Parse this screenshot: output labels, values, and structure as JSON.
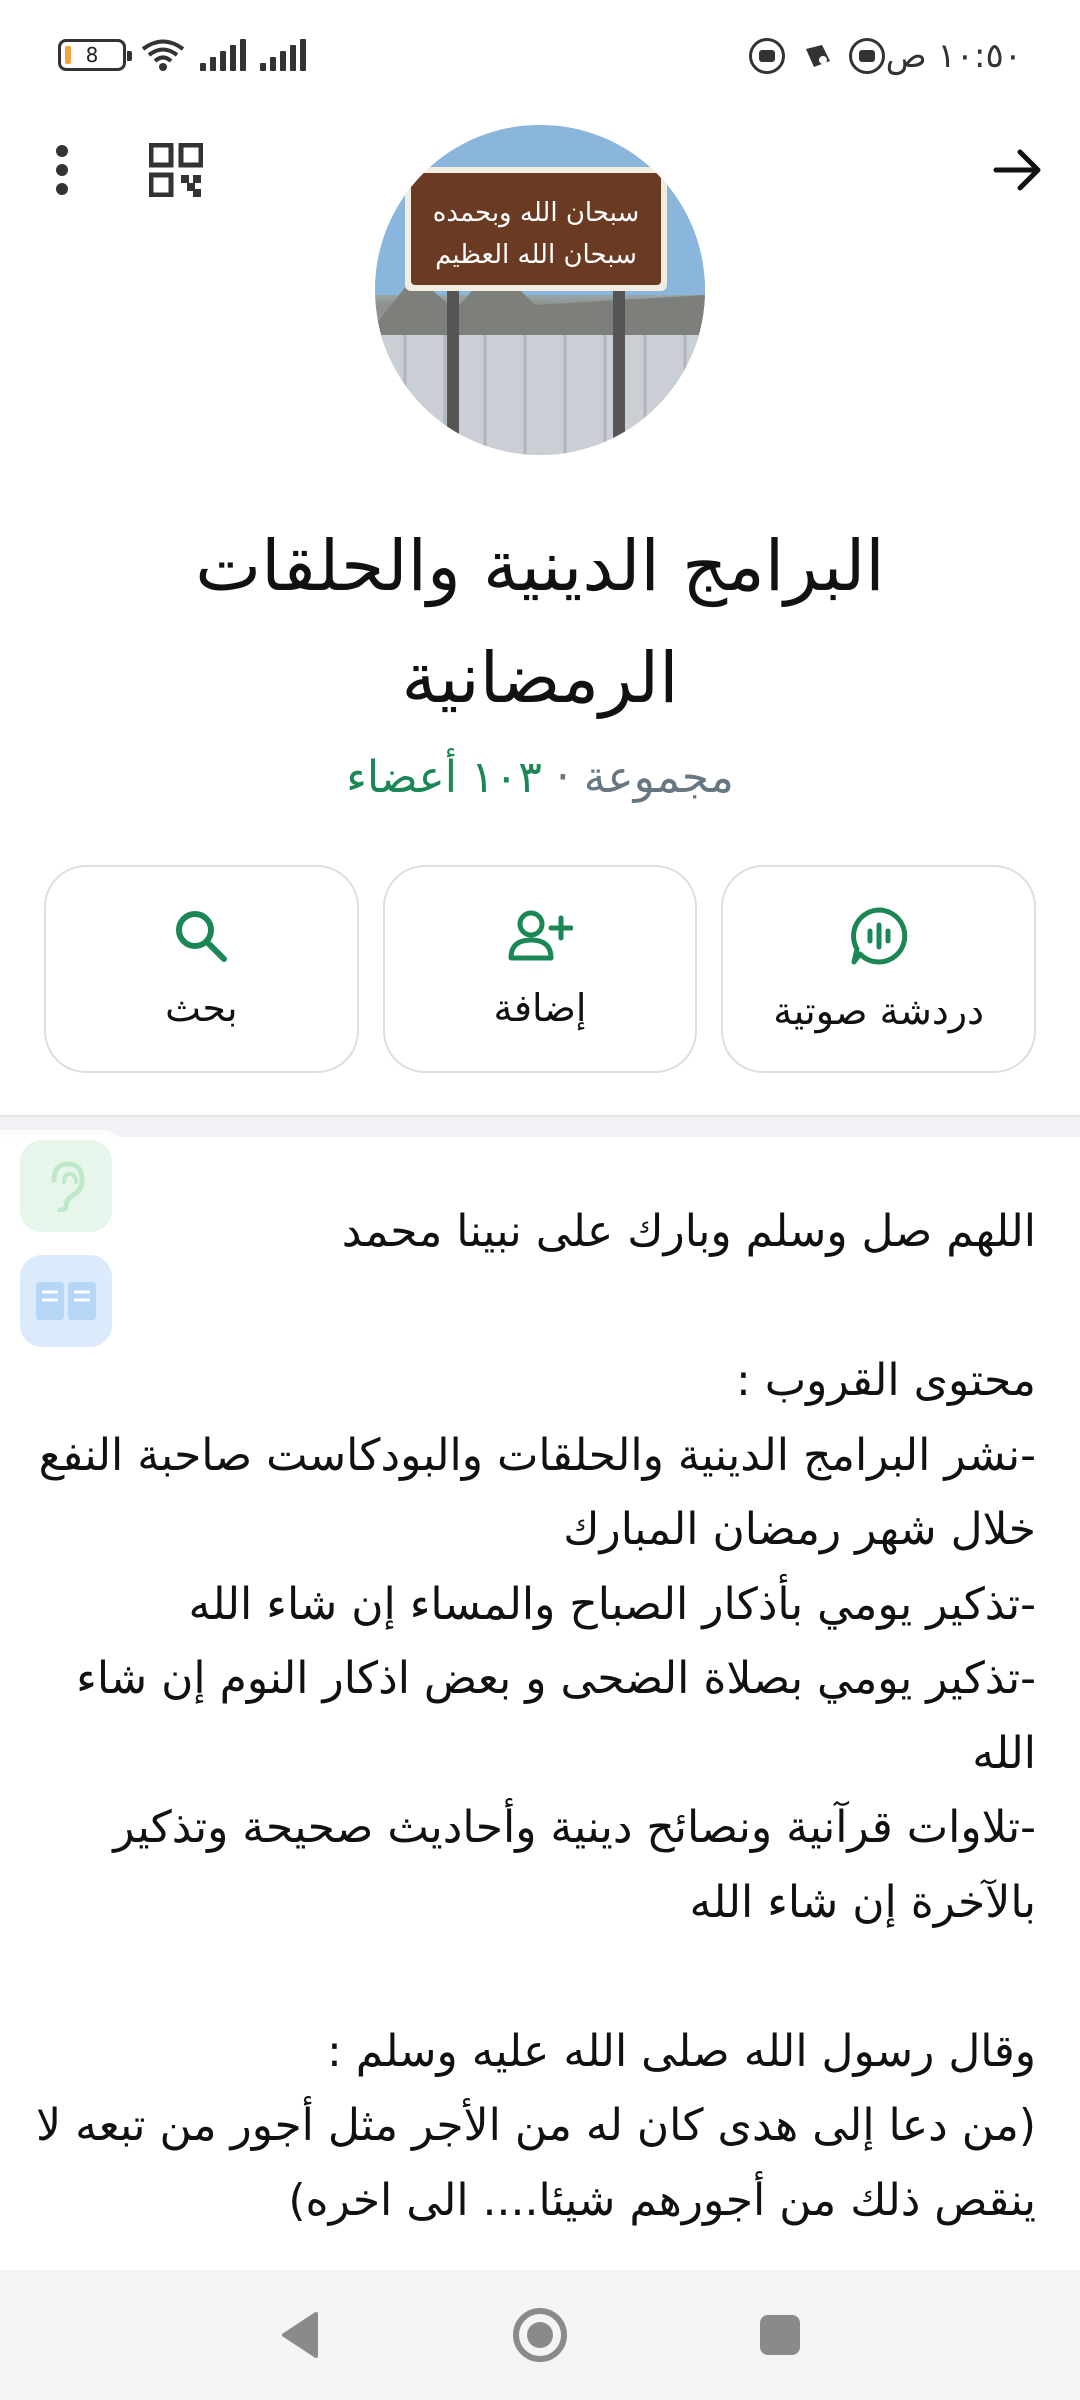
{
  "status_bar": {
    "time": "١٠:٥٠ ص",
    "battery": "8"
  },
  "top_bar": {
    "back_icon": "arrow-back-icon",
    "qr_icon": "qr-code-icon",
    "menu_icon": "more-vert-icon"
  },
  "avatar": {
    "sign_line1": "سبحان الله وبحمده",
    "sign_line2": "سبحان الله العظيم"
  },
  "group": {
    "title": "البرامج الدينية والحلقات الرمضانية",
    "type_label": "مجموعة",
    "separator": " · ",
    "members_label": "١٠٣ أعضاء"
  },
  "actions": [
    {
      "label": "دردشة صوتية",
      "icon": "voice-chat-icon"
    },
    {
      "label": "إضافة",
      "icon": "add-person-icon"
    },
    {
      "label": "بحث",
      "icon": "search-icon"
    }
  ],
  "description": "اللهم صل وسلم وبارك على نبينا محمد\n\nمحتوى القروب :\n-نشر البرامج الدينية والحلقات والبودكاست صاحبة النفع خلال شهر رمضان المبارك\n-تذكير يومي بأذكار الصباح والمساء إن شاء الله\n-تذكير يومي بصلاة الضحى و بعض اذكار النوم إن شاء الله\n-تلاوات قرآنية ونصائح دينية وأحاديث صحيحة وتذكير بالآخرة إن شاء الله\n\nوقال رسول الله صلى الله عليه وسلم :\n(من دعا إلى هدى كان له من الأجر مثل أجور من تبعه لا ينقص ذلك من أجورهم شيئا.... الى اخره)",
  "colors": {
    "accent_green": "#1b8755",
    "text_primary": "#111b21",
    "text_secondary": "#667781"
  },
  "nav": {
    "back": "nav-back-icon",
    "home": "nav-home-icon",
    "recents": "nav-recents-icon"
  }
}
